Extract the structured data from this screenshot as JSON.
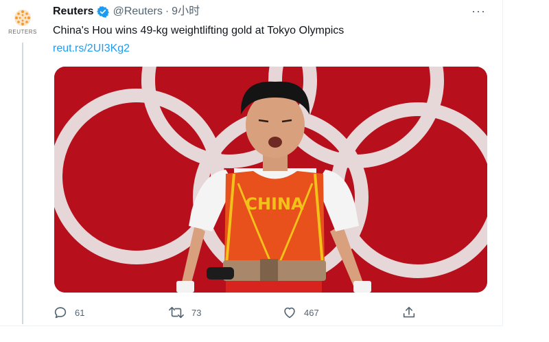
{
  "tweet": {
    "author_name": "Reuters",
    "verified": true,
    "handle": "@Reuters",
    "separator": "·",
    "time": "9小时",
    "text": "China's Hou wins 49-kg weightlifting gold at Tokyo Olympics",
    "link": "reut.rs/2UI3Kg2",
    "avatar_label": "REUTERS",
    "more_label": "···",
    "media": {
      "jersey_text": "CHINA",
      "colors": {
        "background": "#c0121e",
        "rings": "#e9e2e3",
        "jersey": "#e8501c",
        "trim": "#f2c21a"
      }
    },
    "actions": {
      "replies": "61",
      "retweets": "73",
      "likes": "467"
    }
  },
  "colors": {
    "text": "#0f1419",
    "secondary": "#536471",
    "link": "#1d9bf0",
    "verified": "#1d9bf0"
  }
}
